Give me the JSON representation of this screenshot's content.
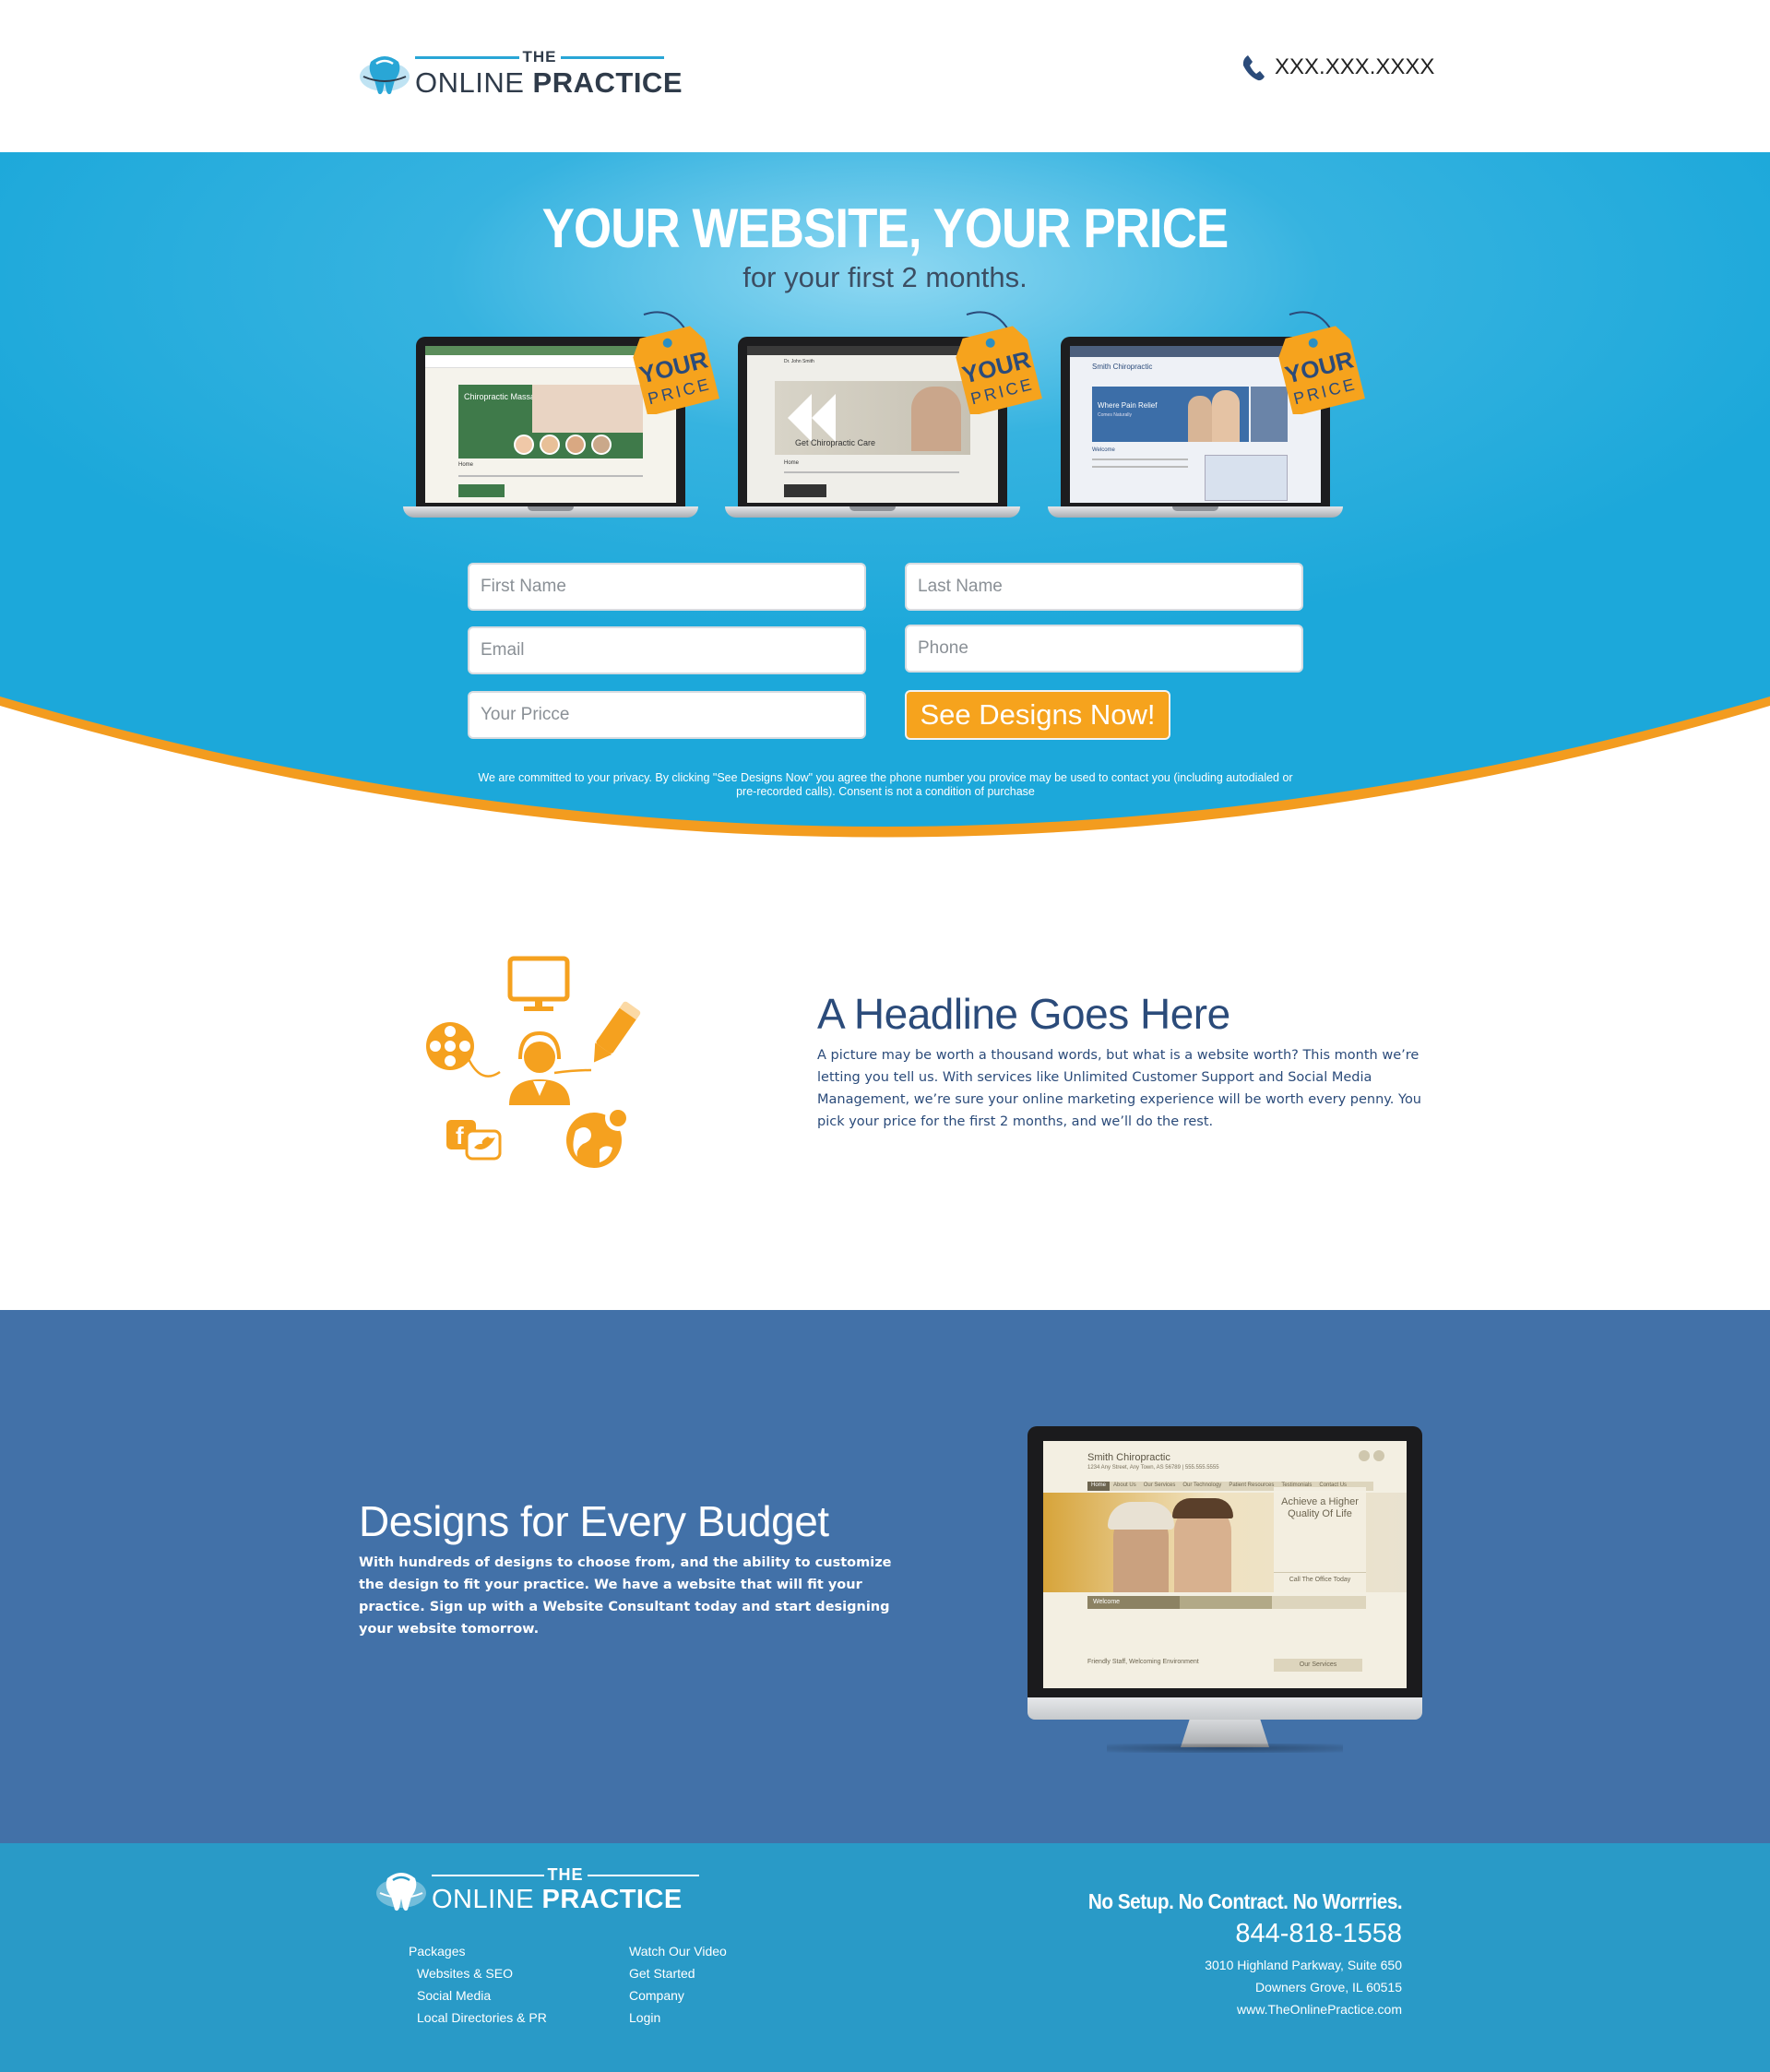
{
  "colors": {
    "hero_blue": "#1da9da",
    "accent_orange": "#f6a31d",
    "navy_text": "#2b4b7a",
    "band_blue": "#4271a8",
    "footer_blue": "#299ac7"
  },
  "header": {
    "logo": {
      "the": "THE",
      "online": "ONLINE",
      "practice": "PRACTICE"
    },
    "phone_icon": "phone-icon",
    "phone": "XXX.XXX.XXXX"
  },
  "hero": {
    "title": "YOUR WEBSITE, YOUR PRICE",
    "subtitle": "for your first 2 months.",
    "price_tag": {
      "line1": "YOUR",
      "line2": "PRICE"
    },
    "laptops": [
      {
        "banner": "Chiropractic Massage",
        "footer": "Home"
      },
      {
        "banner": "Get Chiropractic Care",
        "header": "Dr. John Smith",
        "footer": "Home"
      },
      {
        "site": "Smith Chiropractic",
        "banner": "Where Pain Relief",
        "banner_sub": "Comes Naturally",
        "section": "Welcome"
      }
    ],
    "form": {
      "first_name_placeholder": "First Name",
      "last_name_placeholder": "Last Name",
      "email_placeholder": "Email",
      "phone_placeholder": "Phone",
      "price_placeholder": "Your Pricce",
      "submit_label": "See Designs Now!"
    },
    "privacy_line1": "We are committed to your privacy. By clicking \"See Designs Now\" you agree the phone number you provice may be used to contact you (including autodialed or",
    "privacy_line2": "pre-recorded calls). Consent is not a condition of purchase"
  },
  "feature1": {
    "icons": [
      "monitor-icon",
      "film-reel-icon",
      "support-agent-icon",
      "pencil-icon",
      "social-media-icon",
      "globe-icon"
    ],
    "headline": "A Headline Goes Here",
    "body": "A picture may be worth a thousand words, but what is a website worth? This month we’re letting you tell us. With services like Unlimited Customer Support and Social Media Management, we’re sure your online marketing experience will be worth every penny. You pick your price for the first 2 months, and we’ll do the rest."
  },
  "feature2": {
    "title": "Designs for Every Budget",
    "body": "With hundreds of designs to choose from, and the ability to customize the design to fit your practice. We have a website that will fit your practice. Sign up with a Website Consultant today and start designing your website tomorrow.",
    "monitor": {
      "site_name": "Smith Chiropractic",
      "address": "1234 Any Street, Any Town, AS 56789 | 555.555.5555",
      "nav": [
        "Home",
        "About Us",
        "Our Services",
        "Our Technology",
        "Patient Resources",
        "Testimonials",
        "Contact Us"
      ],
      "side_heading": "Achieve a Higher Quality Of Life",
      "side_cta": "Call The Office Today",
      "welcome": "Welcome",
      "caption": "Friendly Staff, Welcoming Environment",
      "services": "Our Services"
    }
  },
  "footer": {
    "logo": {
      "the": "THE",
      "online": "ONLINE",
      "practice": "PRACTICE"
    },
    "links_col1": [
      "Packages",
      "Websites & SEO",
      "Social Media",
      "Local Directories & PR"
    ],
    "links_col2": [
      "Watch Our Video",
      "Get Started",
      "Company",
      "Login"
    ],
    "tagline": "No Setup. No Contract. No Worrries.",
    "phone": "844-818-1558",
    "address1": "3010 Highland Parkway, Suite 650",
    "address2": "Downers Grove, IL 60515",
    "website": "www.TheOnlinePractice.com"
  }
}
